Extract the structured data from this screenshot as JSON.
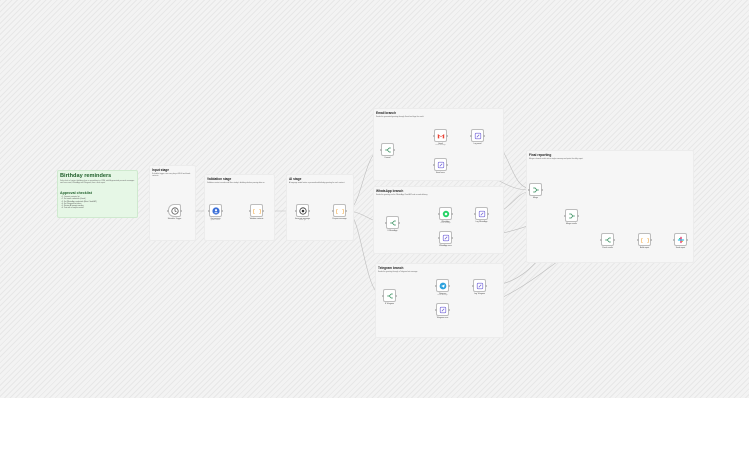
{
  "blueprint": {
    "title": "Birthday reminders",
    "body": "Daily check of contact birthdays from a spreadsheet or CRM, with AI-generated personal messages sent over email, WhatsApp and Telegram, then a final report.",
    "checklist_title": "Approval checklist",
    "checklist": [
      "1. Connect contacts list",
      "2. Set email credentials (Gmail)",
      "3. Set WhatsApp credentials (Meta Cloud API)",
      "4. Set Telegram bot token",
      "5. Review AI prompt wording",
      "6. Test with a sample contact"
    ]
  },
  "stages": {
    "input": {
      "title": "Input stage",
      "body": "Schedule trigger runs every day at 08:00 and loads contacts."
    },
    "validation": {
      "title": "Validation stage",
      "body": "Validates contact records and filters today's birthdays before passing data on."
    },
    "ai": {
      "title": "AI stage",
      "body": "A language model writes a personalised birthday greeting for each contact."
    },
    "email": {
      "title": "Email branch",
      "body": "Sends the generated greeting through Gmail and logs the result."
    },
    "whatsapp": {
      "title": "WhatsApp branch",
      "body": "Sends the greeting via the WhatsApp Cloud API and records delivery."
    },
    "telegram": {
      "title": "Telegram branch",
      "body": "Sends the greeting through a Telegram bot message."
    },
    "final": {
      "title": "Final reporting",
      "body": "Merges channel results into a single summary and posts the daily report."
    }
  },
  "nodes": [
    {
      "id": "schedule",
      "icon": "clock-icon",
      "label": "Schedule Trigger",
      "sub": ""
    },
    {
      "id": "contacts",
      "icon": "user-icon",
      "label": "Get contacts",
      "sub": "getAll: contact"
    },
    {
      "id": "validate",
      "icon": "code-icon",
      "label": "Validate contacts",
      "sub": ""
    },
    {
      "id": "ai",
      "icon": "ai-icon",
      "label": "Generate message",
      "sub": "model: gpt"
    },
    {
      "id": "prepare",
      "icon": "code-icon",
      "label": "Prepare message",
      "sub": ""
    },
    {
      "id": "email-if",
      "icon": "branch-icon",
      "label": "If email",
      "sub": ""
    },
    {
      "id": "gmail",
      "icon": "gmail-icon",
      "label": "Gmail",
      "sub": "send: message"
    },
    {
      "id": "email-log",
      "icon": "edit-icon",
      "label": "Log email",
      "sub": ""
    },
    {
      "id": "email-err",
      "icon": "edit-icon",
      "label": "Email error",
      "sub": ""
    },
    {
      "id": "wa-if",
      "icon": "branch-icon",
      "label": "If WhatsApp",
      "sub": ""
    },
    {
      "id": "whatsapp",
      "icon": "whatsapp-icon",
      "label": "WhatsApp",
      "sub": "send: message"
    },
    {
      "id": "wa-log",
      "icon": "edit-icon",
      "label": "Log WhatsApp",
      "sub": ""
    },
    {
      "id": "wa-err",
      "icon": "edit-icon",
      "label": "WhatsApp error",
      "sub": ""
    },
    {
      "id": "tg-if",
      "icon": "branch-icon",
      "label": "If Telegram",
      "sub": ""
    },
    {
      "id": "telegram",
      "icon": "telegram-icon",
      "label": "Telegram",
      "sub": "send: message"
    },
    {
      "id": "tg-log",
      "icon": "edit-icon",
      "label": "Log Telegram",
      "sub": ""
    },
    {
      "id": "tg-err",
      "icon": "edit-icon",
      "label": "Telegram error",
      "sub": ""
    },
    {
      "id": "merge1",
      "icon": "merge-icon",
      "label": "Merge",
      "sub": ""
    },
    {
      "id": "merge2",
      "icon": "merge-icon",
      "label": "Merge results",
      "sub": ""
    },
    {
      "id": "summary-if",
      "icon": "branch-icon",
      "label": "Check results",
      "sub": ""
    },
    {
      "id": "report",
      "icon": "code-icon",
      "label": "Build report",
      "sub": ""
    },
    {
      "id": "slack",
      "icon": "slack-icon",
      "label": "Send report",
      "sub": ""
    }
  ],
  "colors": {
    "gmail": "#ea4335",
    "whatsapp": "#25d366",
    "telegram": "#2aa1de",
    "code": "#f0a030",
    "edit": "#6b5bd6",
    "blueprint": "#1f5f2a"
  }
}
